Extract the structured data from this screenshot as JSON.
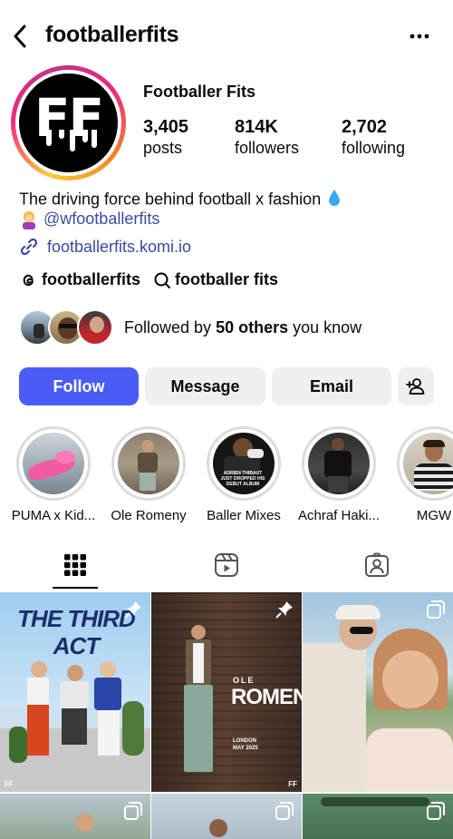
{
  "header": {
    "username": "footballerfits"
  },
  "profile": {
    "avatar_text": "FF",
    "display_name": "Footballer Fits",
    "stats": [
      {
        "count": "3,405",
        "label": "posts"
      },
      {
        "count": "814K",
        "label": "followers"
      },
      {
        "count": "2,702",
        "label": "following"
      }
    ],
    "bio_line1": "The driving force behind football x fashion",
    "bio_mention": "@wfootballerfits",
    "bio_link": "footballerfits.komi.io",
    "threads_handle": "footballerfits",
    "threads_name": "footballer fits",
    "followed_prefix": "Followed by ",
    "followed_count": "50 others",
    "followed_suffix": " you know"
  },
  "actions": {
    "follow": "Follow",
    "message": "Message",
    "email": "Email"
  },
  "highlights": [
    {
      "label": "PUMA x Kid..."
    },
    {
      "label": "Ole Romeny"
    },
    {
      "label": "Baller Mixes"
    },
    {
      "label": "Achraf Haki..."
    },
    {
      "label": "MGW"
    }
  ],
  "posts": {
    "post1_title": "THE THIRD ACT",
    "post1_tag": "FF",
    "post2_title": "ROMENY",
    "post2_sub": "OLE",
    "post2_date": "LONDON\nMAY 2025",
    "post2_tag": "FF",
    "highlight3_caption": "ADRIEN THIBAUT\nJUST DROPPED HIS\nDEBUT ALBUM"
  },
  "colors": {
    "follow_bg": "#4a5cf5",
    "link": "#3b4a9e",
    "button_bg": "#efefef"
  }
}
